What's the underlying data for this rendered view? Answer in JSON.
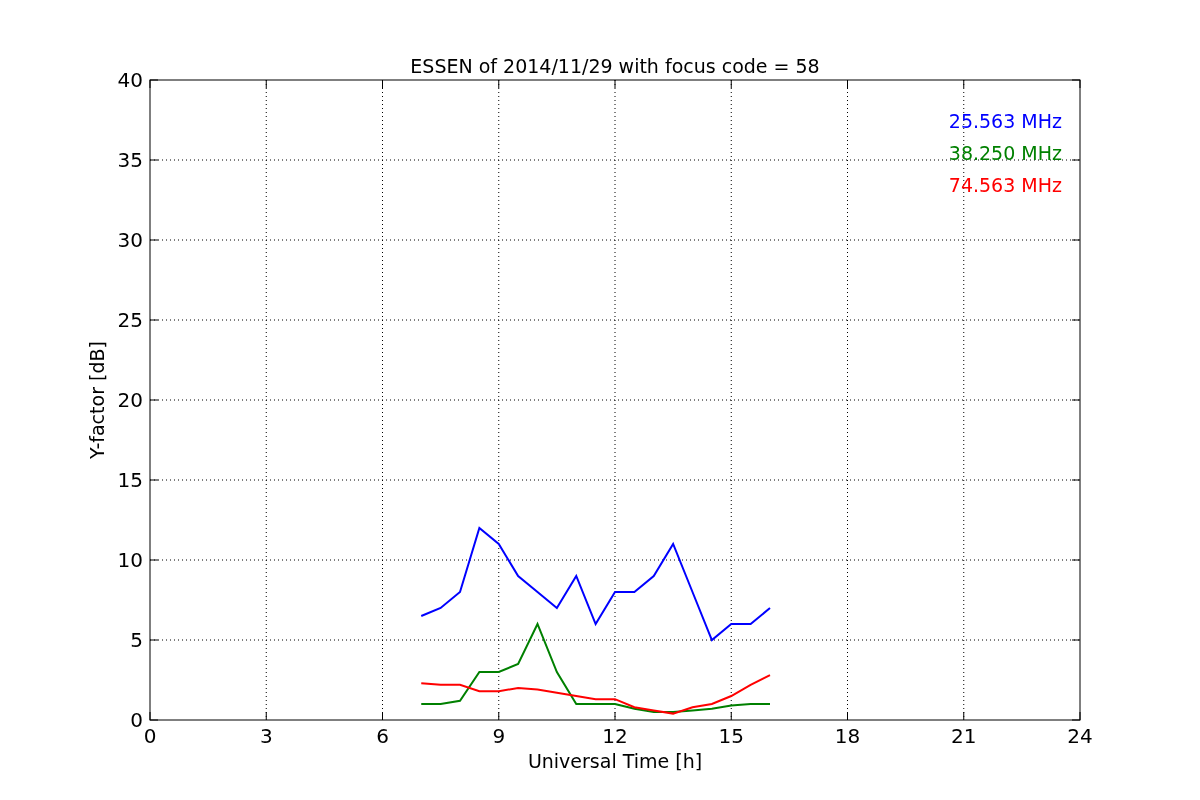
{
  "figure": {
    "chart_data": {
      "type": "line",
      "title": "ESSEN of 2014/11/29 with focus code = 58",
      "xlabel": "Universal Time [h]",
      "ylabel": "Y-factor [dB]",
      "x": [
        7,
        7.5,
        8,
        8.5,
        9,
        9.5,
        10,
        10.5,
        11,
        11.5,
        12,
        12.5,
        13,
        13.5,
        14,
        14.5,
        15,
        15.5,
        16
      ],
      "grid": true,
      "xlim": [
        0,
        24
      ],
      "ylim": [
        0,
        40
      ],
      "xticks": [
        0,
        3,
        6,
        9,
        12,
        15,
        18,
        21,
        24
      ],
      "yticks": [
        0,
        5,
        10,
        15,
        20,
        25,
        30,
        35,
        40
      ],
      "series": [
        {
          "name": "25.563 MHz",
          "color": "#0000ff",
          "values": [
            6.5,
            7,
            8,
            12,
            11,
            9,
            8,
            7,
            9,
            6,
            8,
            8,
            9,
            11,
            8,
            5,
            6,
            6,
            7
          ]
        },
        {
          "name": "38.250 MHz",
          "color": "#008000",
          "values": [
            1,
            1,
            1.2,
            3,
            3,
            3.5,
            6,
            3,
            1,
            1,
            1,
            0.7,
            0.5,
            0.5,
            0.6,
            0.7,
            0.9,
            1,
            1
          ]
        },
        {
          "name": "74.563 MHz",
          "color": "#ff0000",
          "values": [
            2.3,
            2.2,
            2.2,
            1.8,
            1.8,
            2,
            1.9,
            1.7,
            1.5,
            1.3,
            1.3,
            0.8,
            0.6,
            0.4,
            0.8,
            1,
            1.5,
            2.2,
            2.8
          ]
        }
      ]
    }
  }
}
